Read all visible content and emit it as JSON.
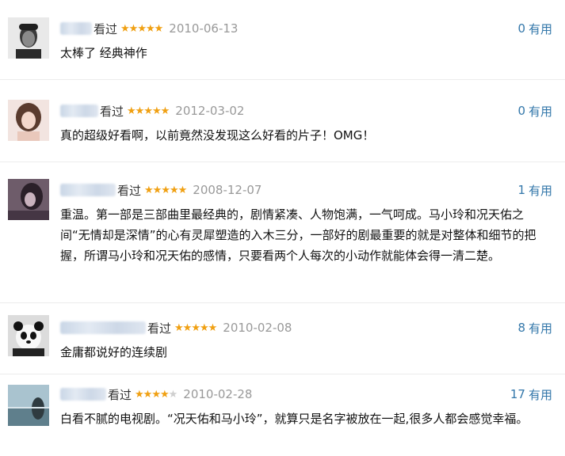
{
  "reviews": [
    {
      "watched_label": "看过",
      "rating": 5,
      "date": "2010-06-13",
      "useful_count": "0",
      "useful_label": "有用",
      "comment": "太棒了 经典神作"
    },
    {
      "watched_label": "看过",
      "rating": 5,
      "date": "2012-03-02",
      "useful_count": "0",
      "useful_label": "有用",
      "comment": "真的超级好看啊，以前竟然没发现这么好看的片子！OMG！"
    },
    {
      "watched_label": "看过",
      "rating": 5,
      "date": "2008-12-07",
      "useful_count": "1",
      "useful_label": "有用",
      "comment": "重温。第一部是三部曲里最经典的，剧情紧凑、人物饱满，一气呵成。马小玲和况天佑之间“无情却是深情”的心有灵犀塑造的入木三分，一部好的剧最重要的就是对整体和细节的把握，所谓马小玲和况天佑的感情，只要看两个人每次的小动作就能体会得一清二楚。"
    },
    {
      "watched_label": "看过",
      "rating": 5,
      "date": "2010-02-08",
      "useful_count": "8",
      "useful_label": "有用",
      "comment": "金庸都说好的连续剧"
    },
    {
      "watched_label": "看过",
      "rating": 4,
      "date": "2010-02-28",
      "useful_count": "17",
      "useful_label": "有用",
      "comment": "白看不腻的电视剧。“况天佑和马小玲”，就算只是名字被放在一起,很多人都会感觉幸福。"
    }
  ],
  "colors": {
    "star_on": "#f0a012",
    "star_off": "#cfcfcf",
    "link": "#3377aa",
    "date": "#999999"
  }
}
